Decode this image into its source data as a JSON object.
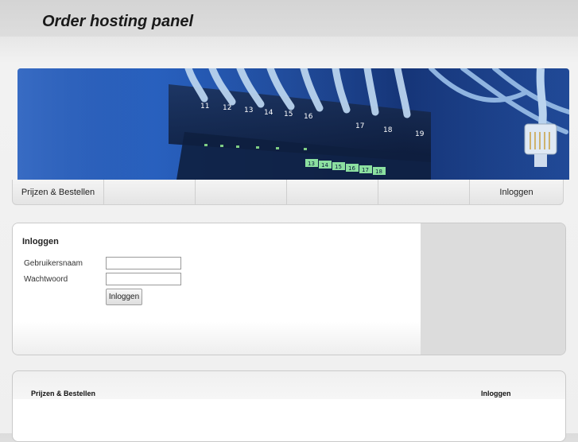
{
  "header": {
    "title": "Order hosting panel"
  },
  "banner": {
    "port_numbers_top": [
      "11",
      "12",
      "13",
      "14",
      "15",
      "16",
      "17",
      "18",
      "19"
    ],
    "port_numbers_lower": [
      "13",
      "14",
      "15",
      "16",
      "17",
      "18"
    ]
  },
  "nav": {
    "items": [
      {
        "label": "Prijzen & Bestellen"
      },
      {
        "label": ""
      },
      {
        "label": ""
      },
      {
        "label": ""
      },
      {
        "label": ""
      },
      {
        "label": "Inloggen"
      }
    ]
  },
  "login": {
    "title": "Inloggen",
    "username_label": "Gebruikersnaam",
    "username_value": "",
    "password_label": "Wachtwoord",
    "password_value": "",
    "submit_label": "Inloggen"
  },
  "footer": {
    "link_prices": "Prijzen & Bestellen",
    "link_login": "Inloggen"
  }
}
